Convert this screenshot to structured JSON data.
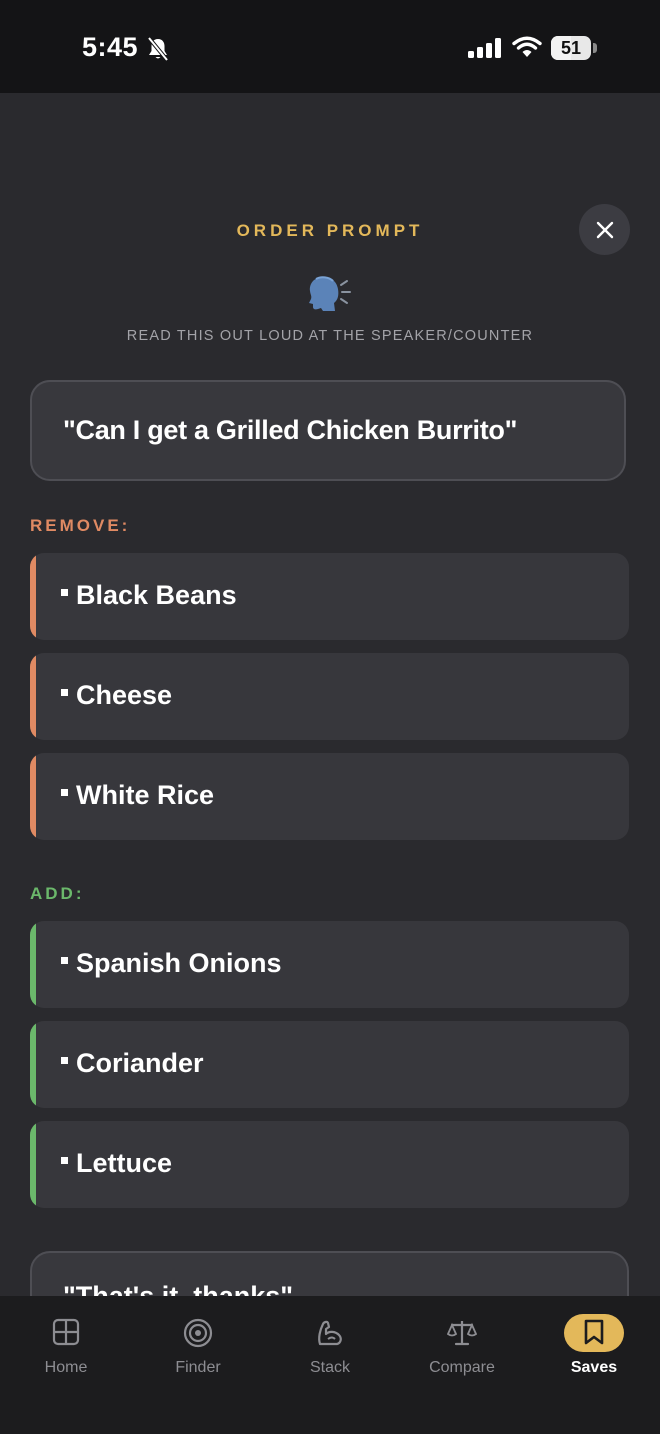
{
  "status_bar": {
    "time": "5:45",
    "battery": "51"
  },
  "header": {
    "title": "ORDER PROMPT",
    "instruction": "READ THIS OUT LOUD AT THE SPEAKER/COUNTER"
  },
  "quote": {
    "text": "\"Can I get a Grilled Chicken Burrito\""
  },
  "remove": {
    "label": "REMOVE:",
    "items": [
      "Black Beans",
      "Cheese",
      "White Rice"
    ]
  },
  "add": {
    "label": "ADD:",
    "items": [
      "Spanish Onions",
      "Coriander",
      "Lettuce"
    ]
  },
  "closing_quote": {
    "text": "\"That's it, thanks\""
  },
  "tabs": [
    {
      "label": "Home",
      "icon": "grid-icon"
    },
    {
      "label": "Finder",
      "icon": "target-icon"
    },
    {
      "label": "Stack",
      "icon": "flexed-arm-icon"
    },
    {
      "label": "Compare",
      "icon": "scale-icon"
    },
    {
      "label": "Saves",
      "icon": "bookmark-icon",
      "active": true
    }
  ],
  "colors": {
    "accent_gold": "#e3b85a",
    "remove_orange": "#e08a63",
    "add_green": "#6bb86b",
    "background": "#2a2a2e"
  }
}
